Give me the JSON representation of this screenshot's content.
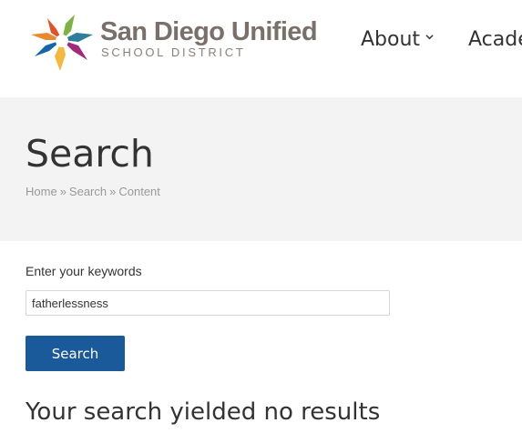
{
  "header": {
    "brand_name": "San Diego Unified",
    "brand_subtitle": "SCHOOL DISTRICT",
    "nav": [
      {
        "label": "About"
      },
      {
        "label": "Acade"
      }
    ]
  },
  "banner": {
    "title": "Search",
    "breadcrumb": [
      "Home",
      "Search",
      "Content"
    ],
    "breadcrumb_separator": "»"
  },
  "search": {
    "label": "Enter your keywords",
    "value": "fatherlessness",
    "button_label": "Search",
    "result_message": "Your search yielded no results"
  },
  "icons": {
    "nav_chevron": "chevron-down-icon"
  },
  "colors": {
    "button_blue": "#1a5a9a",
    "banner_bg": "#f3f3f3",
    "brand_gray": "#7a706a"
  }
}
